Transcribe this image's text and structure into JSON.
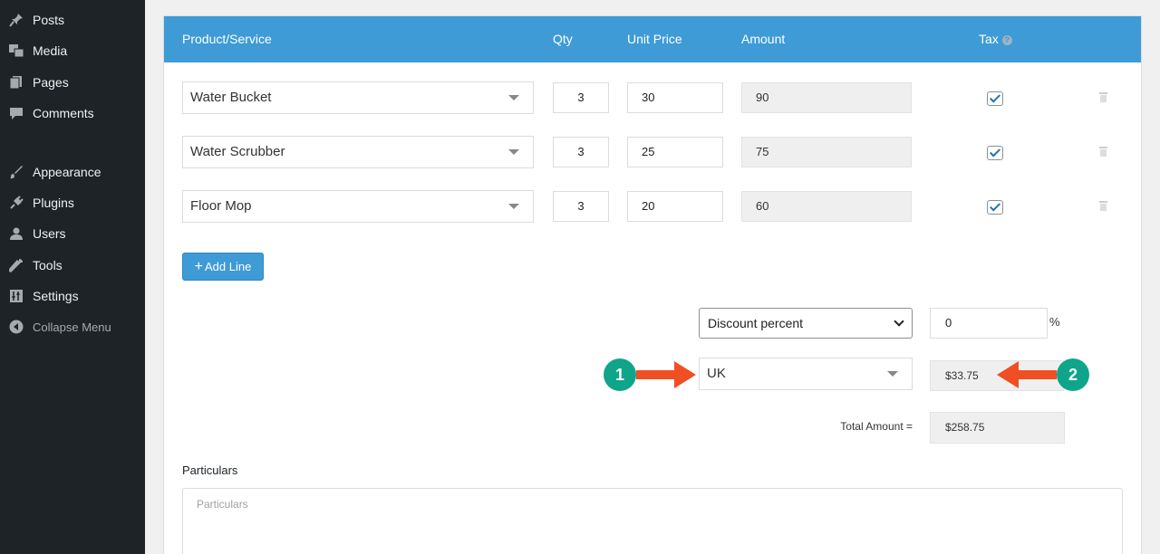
{
  "sidebar": {
    "items": [
      {
        "label": "Posts",
        "icon": "pin-icon"
      },
      {
        "label": "Media",
        "icon": "media-icon"
      },
      {
        "label": "Pages",
        "icon": "pages-icon"
      },
      {
        "label": "Comments",
        "icon": "comment-icon"
      },
      {
        "label": "Appearance",
        "icon": "brush-icon"
      },
      {
        "label": "Plugins",
        "icon": "plugin-icon"
      },
      {
        "label": "Users",
        "icon": "user-icon"
      },
      {
        "label": "Tools",
        "icon": "wrench-icon"
      },
      {
        "label": "Settings",
        "icon": "settings-icon"
      },
      {
        "label": "Collapse Menu",
        "icon": "collapse-icon"
      }
    ]
  },
  "table": {
    "headers": {
      "product": "Product/Service",
      "qty": "Qty",
      "unit_price": "Unit Price",
      "amount": "Amount",
      "tax": "Tax"
    },
    "rows": [
      {
        "product": "Water Bucket",
        "qty": "3",
        "unit_price": "30",
        "amount": "90",
        "taxed": true
      },
      {
        "product": "Water Scrubber",
        "qty": "3",
        "unit_price": "25",
        "amount": "75",
        "taxed": true
      },
      {
        "product": "Floor Mop",
        "qty": "3",
        "unit_price": "20",
        "amount": "60",
        "taxed": true
      }
    ]
  },
  "add_line_label": "Add Line",
  "discount": {
    "type": "Discount percent",
    "value": "0",
    "unit": "%"
  },
  "tax": {
    "region": "UK",
    "amount": "$33.75"
  },
  "total": {
    "label": "Total Amount =",
    "value": "$258.75"
  },
  "particulars": {
    "label": "Particulars",
    "placeholder": "Particulars"
  },
  "annotations": {
    "badge1": "1",
    "badge2": "2"
  },
  "colors": {
    "header_blue": "#3e9bd6",
    "sidebar_bg": "#1d2327",
    "badge_green": "#0fa58a",
    "arrow_orange": "#f04e23"
  }
}
